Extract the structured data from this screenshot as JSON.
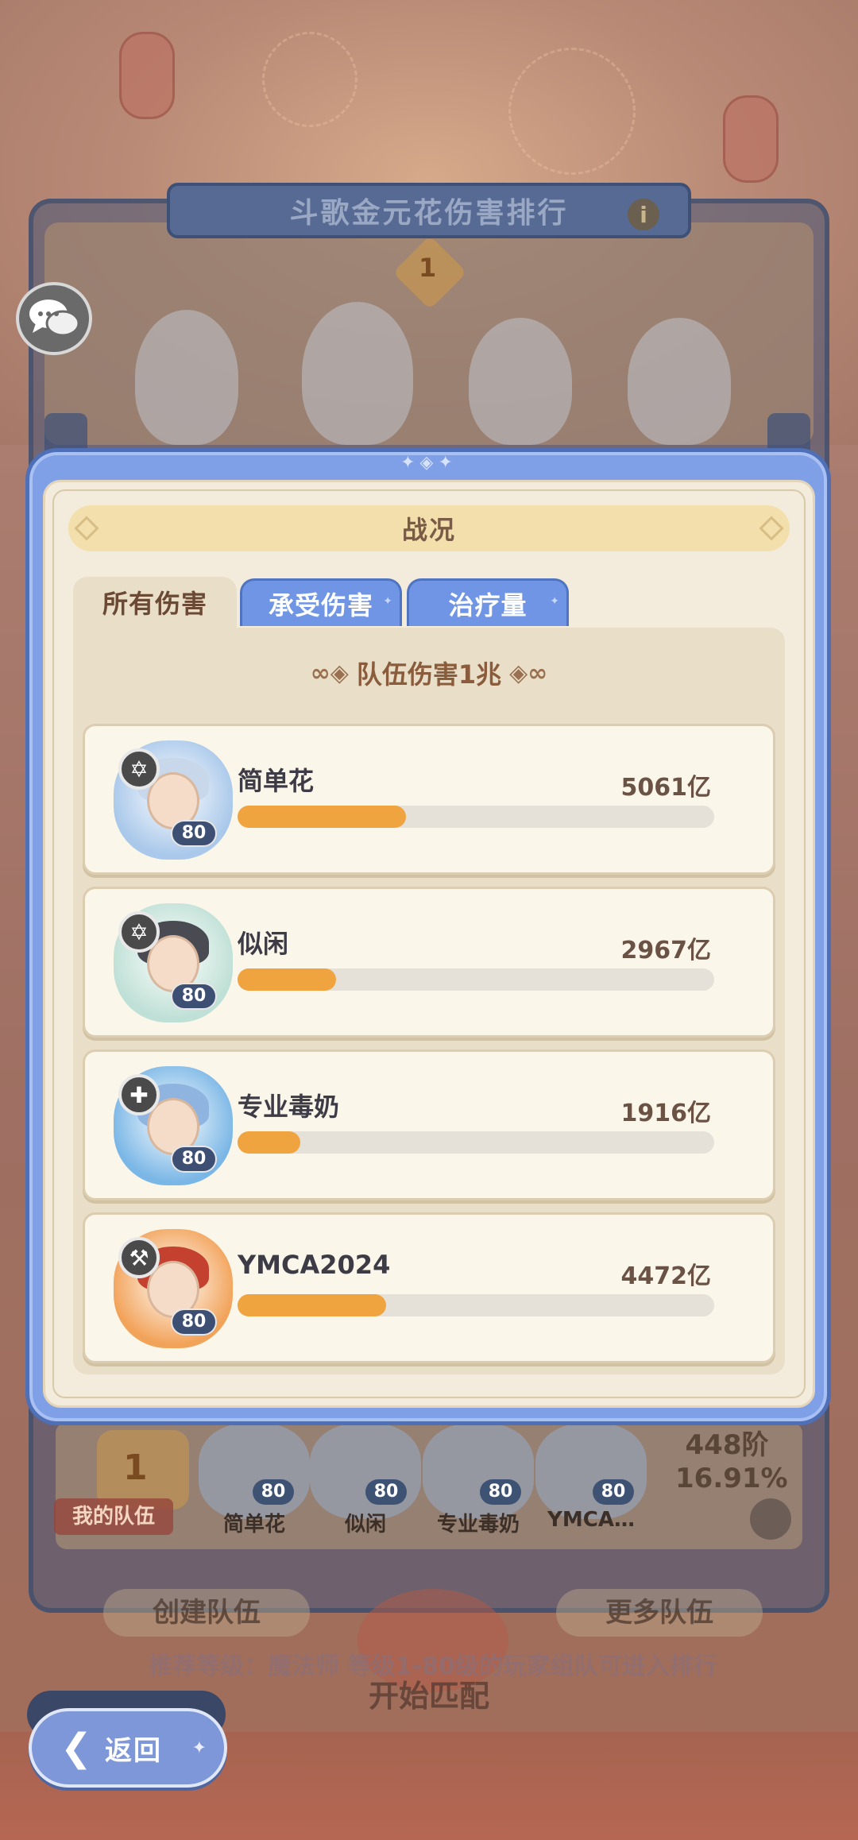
{
  "background": {
    "ranking_title": "斗歌金元花伤害排行",
    "info_icon": "info-icon",
    "rank_number": "1",
    "my_team_label": "我的队伍",
    "my_team_rank": "1",
    "tier": "448阶",
    "percent": "16.91%",
    "team_members": [
      {
        "name": "简单花",
        "level": "80"
      },
      {
        "name": "似闲",
        "level": "80"
      },
      {
        "name": "专业毒奶",
        "level": "80"
      },
      {
        "name": "YMCA…",
        "level": "80"
      }
    ],
    "create_team": "创建队伍",
    "more_team": "更多队伍",
    "recommend": "推荐等级：魔法师 等级1-80级的玩家组队可进入排行",
    "start_match": "开始匹配"
  },
  "dialog": {
    "title": "战况",
    "tabs": [
      {
        "label": "所有伤害",
        "active": true
      },
      {
        "label": "承受伤害",
        "active": false
      },
      {
        "label": "治疗量",
        "active": false
      }
    ],
    "team_total": "队伍伤害1兆",
    "rows": [
      {
        "name": "简单花",
        "value": "5061亿",
        "level": "80",
        "role": "✡",
        "fraction": 0.353,
        "theme": "#a9c8ea",
        "hair": "#c8d8ea"
      },
      {
        "name": "似闲",
        "value": "2967亿",
        "level": "80",
        "role": "✡",
        "fraction": 0.207,
        "theme": "#bfe0d6",
        "hair": "#4a4a52"
      },
      {
        "name": "专业毒奶",
        "value": "1916亿",
        "level": "80",
        "role": "✚",
        "fraction": 0.131,
        "theme": "#7bb7e6",
        "hair": "#8fb4e0"
      },
      {
        "name": "YMCA2024",
        "value": "4472亿",
        "level": "80",
        "role": "⚒",
        "fraction": 0.311,
        "theme": "#f2a35a",
        "hair": "#c3412e"
      }
    ]
  },
  "back_button": {
    "label": "返回",
    "icon": "back-chevron-icon"
  },
  "colors": {
    "dialog_border": "#7f9fe6",
    "tab_inactive": "#6f95e4",
    "bar_fill": "#f0a440",
    "bar_track": "#e5e1d9"
  }
}
